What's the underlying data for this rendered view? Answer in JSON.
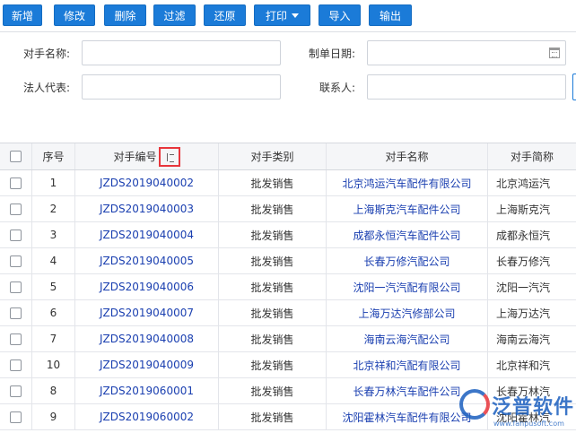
{
  "toolbar": {
    "buttons": [
      {
        "label": "新增"
      },
      {
        "label": "修改"
      },
      {
        "label": "删除"
      },
      {
        "label": "过滤"
      },
      {
        "label": "还原"
      },
      {
        "label": "打印"
      },
      {
        "label": "导入"
      },
      {
        "label": "输出"
      }
    ]
  },
  "form": {
    "counterpart_name_label": "对手名称:",
    "doc_date_label": "制单日期:",
    "legal_rep_label": "法人代表:",
    "contact_label": "联系人:",
    "counterpart_name_value": "",
    "doc_date_value": "",
    "legal_rep_value": "",
    "contact_value": ""
  },
  "grid": {
    "columns": [
      "",
      "序号",
      "对手编号",
      "对手类别",
      "对手名称",
      "对手简称"
    ],
    "rows": [
      {
        "seq": "1",
        "code": "JZDS2019040002",
        "category": "批发销售",
        "name": "北京鸿运汽车配件有限公司",
        "short": "北京鸿运汽"
      },
      {
        "seq": "2",
        "code": "JZDS2019040003",
        "category": "批发销售",
        "name": "上海斯克汽车配件公司",
        "short": "上海斯克汽"
      },
      {
        "seq": "3",
        "code": "JZDS2019040004",
        "category": "批发销售",
        "name": "成都永恒汽车配件公司",
        "short": "成都永恒汽"
      },
      {
        "seq": "4",
        "code": "JZDS2019040005",
        "category": "批发销售",
        "name": "长春万修汽配公司",
        "short": "长春万修汽"
      },
      {
        "seq": "5",
        "code": "JZDS2019040006",
        "category": "批发销售",
        "name": "沈阳一汽汽配有限公司",
        "short": "沈阳一汽汽"
      },
      {
        "seq": "6",
        "code": "JZDS2019040007",
        "category": "批发销售",
        "name": "上海万达汽修部公司",
        "short": "上海万达汽"
      },
      {
        "seq": "7",
        "code": "JZDS2019040008",
        "category": "批发销售",
        "name": "海南云海汽配公司",
        "short": "海南云海汽"
      },
      {
        "seq": "10",
        "code": "JZDS2019040009",
        "category": "批发销售",
        "name": "北京祥和汽配有限公司",
        "short": "北京祥和汽"
      },
      {
        "seq": "8",
        "code": "JZDS2019060001",
        "category": "批发销售",
        "name": "长春万林汽车配件公司",
        "short": "长春万林汽"
      },
      {
        "seq": "9",
        "code": "JZDS2019060002",
        "category": "批发销售",
        "name": "沈阳霍林汽车配件有限公司",
        "short": "沈阳霍林汽"
      }
    ]
  },
  "watermark": {
    "brand": "泛普软件",
    "url": "www.fanpusoft.com"
  },
  "colors": {
    "primary_button": "#1b7bd8",
    "link_text": "#1a3fb0",
    "highlight_box": "#e8363c",
    "header_bg": "#f5f6f8"
  }
}
